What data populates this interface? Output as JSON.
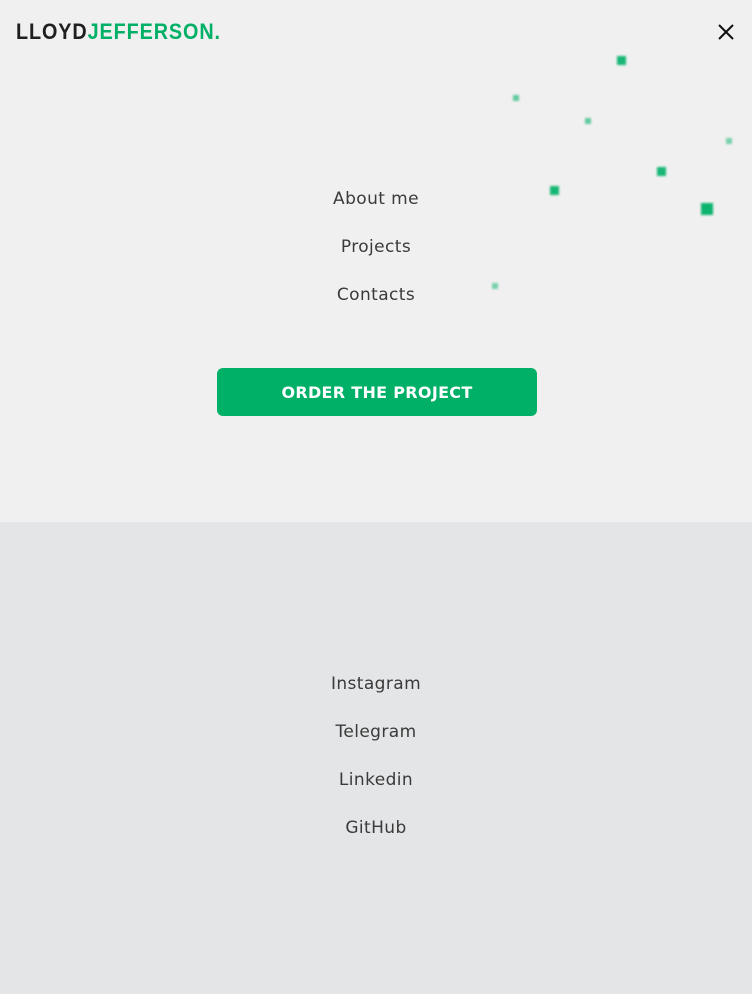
{
  "brand": {
    "first": "LLOYD",
    "last": "JEFFERSON."
  },
  "colors": {
    "accent": "#00b067",
    "top_bg": "#f0f0f0",
    "bottom_bg": "#e4e5e7",
    "text": "#3a3a3a"
  },
  "icons": {
    "close": "close-icon"
  },
  "nav": {
    "items": [
      {
        "label": "About me"
      },
      {
        "label": "Projects"
      },
      {
        "label": "Contacts"
      }
    ]
  },
  "cta": {
    "label": "ORDER THE PROJECT"
  },
  "social": {
    "items": [
      {
        "label": "Instagram"
      },
      {
        "label": "Telegram"
      },
      {
        "label": "Linkedin"
      },
      {
        "label": "GitHub"
      }
    ]
  }
}
